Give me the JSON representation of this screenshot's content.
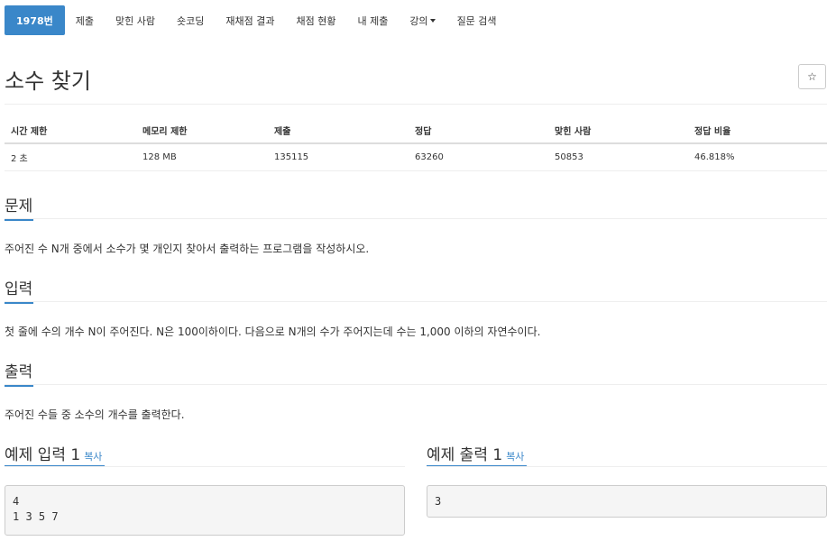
{
  "nav": {
    "items": [
      {
        "label": "1978번",
        "active": true
      },
      {
        "label": "제출"
      },
      {
        "label": "맞힌 사람"
      },
      {
        "label": "숏코딩"
      },
      {
        "label": "재채점 결과"
      },
      {
        "label": "채점 현황"
      },
      {
        "label": "내 제출"
      },
      {
        "label": "강의"
      },
      {
        "label": "질문 검색"
      }
    ]
  },
  "title": "소수 찾기",
  "star": "☆",
  "stats": {
    "headers": [
      "시간 제한",
      "메모리 제한",
      "제출",
      "정답",
      "맞힌 사람",
      "정답 비율"
    ],
    "values": [
      "2 초",
      "128 MB",
      "135115",
      "63260",
      "50853",
      "46.818%"
    ]
  },
  "problem": {
    "heading": "문제",
    "text": "주어진 수 N개 중에서 소수가 몇 개인지 찾아서 출력하는 프로그램을 작성하시오."
  },
  "input": {
    "heading": "입력",
    "text": "첫 줄에 수의 개수 N이 주어진다. N은 100이하이다. 다음으로 N개의 수가 주어지는데 수는 1,000 이하의 자연수이다."
  },
  "output": {
    "heading": "출력",
    "text": "주어진 수들 중 소수의 개수를 출력한다."
  },
  "sample_input": {
    "heading": "예제 입력 1",
    "copy": "복사",
    "content": "4\n1 3 5 7"
  },
  "sample_output": {
    "heading": "예제 출력 1",
    "copy": "복사",
    "content": "3"
  },
  "colors": {
    "accent": "#3a87c9"
  }
}
